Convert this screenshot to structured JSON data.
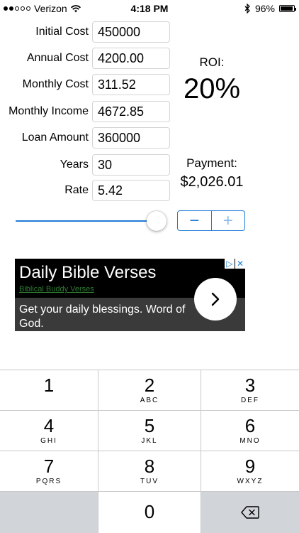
{
  "status_bar": {
    "carrier": "Verizon",
    "time": "4:18 PM",
    "battery": "96%",
    "battery_level": 0.96,
    "signal_bars": 2,
    "signal_total": 5
  },
  "form": {
    "initial_cost_label": "Initial Cost",
    "initial_cost_value": "450000",
    "annual_cost_label": "Annual Cost",
    "annual_cost_value": "4200.00",
    "monthly_cost_label": "Monthly Cost",
    "monthly_cost_value": "311.52",
    "monthly_income_label": "Monthly Income",
    "monthly_income_value": "4672.85",
    "loan_amount_label": "Loan Amount",
    "loan_amount_value": "360000",
    "years_label": "Years",
    "years_value": "30",
    "rate_label": "Rate",
    "rate_value": "5.42"
  },
  "results": {
    "roi_label": "ROI:",
    "roi_value": "20%",
    "payment_label": "Payment:",
    "payment_value": "$2,026.01"
  },
  "controls": {
    "slider_level": 0.92,
    "stepper_minus": "−",
    "stepper_plus": "+",
    "accent_color": "#1f7bd6"
  },
  "ad": {
    "title": "Daily Bible Verses",
    "sponsor": "Biblical Buddy Verses",
    "description": "Get your daily blessings. Word of God.",
    "choices_icon": "ad-choices-icon"
  },
  "keypad": {
    "keys": [
      {
        "num": "1",
        "letters": ""
      },
      {
        "num": "2",
        "letters": "ABC"
      },
      {
        "num": "3",
        "letters": "DEF"
      },
      {
        "num": "4",
        "letters": "GHI"
      },
      {
        "num": "5",
        "letters": "JKL"
      },
      {
        "num": "6",
        "letters": "MNO"
      },
      {
        "num": "7",
        "letters": "PQRS"
      },
      {
        "num": "8",
        "letters": "TUV"
      },
      {
        "num": "9",
        "letters": "WXYZ"
      },
      {
        "num": "0",
        "letters": ""
      }
    ]
  }
}
